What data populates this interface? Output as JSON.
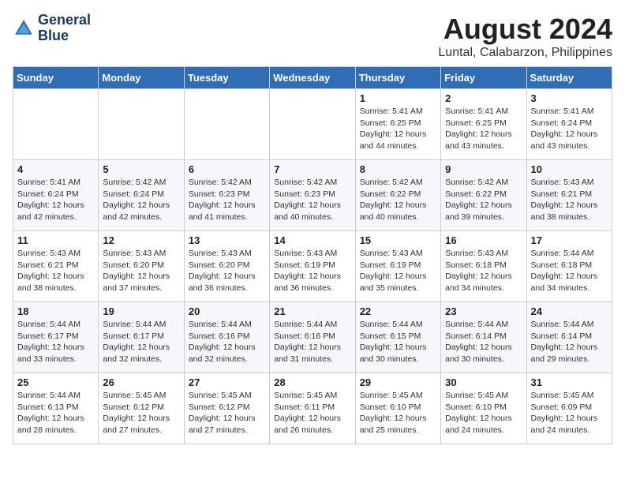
{
  "header": {
    "logo_line1": "General",
    "logo_line2": "Blue",
    "month_year": "August 2024",
    "location": "Luntal, Calabarzon, Philippines"
  },
  "weekdays": [
    "Sunday",
    "Monday",
    "Tuesday",
    "Wednesday",
    "Thursday",
    "Friday",
    "Saturday"
  ],
  "weeks": [
    [
      {
        "day": "",
        "info": ""
      },
      {
        "day": "",
        "info": ""
      },
      {
        "day": "",
        "info": ""
      },
      {
        "day": "",
        "info": ""
      },
      {
        "day": "1",
        "info": "Sunrise: 5:41 AM\nSunset: 6:25 PM\nDaylight: 12 hours\nand 44 minutes."
      },
      {
        "day": "2",
        "info": "Sunrise: 5:41 AM\nSunset: 6:25 PM\nDaylight: 12 hours\nand 43 minutes."
      },
      {
        "day": "3",
        "info": "Sunrise: 5:41 AM\nSunset: 6:24 PM\nDaylight: 12 hours\nand 43 minutes."
      }
    ],
    [
      {
        "day": "4",
        "info": "Sunrise: 5:41 AM\nSunset: 6:24 PM\nDaylight: 12 hours\nand 42 minutes."
      },
      {
        "day": "5",
        "info": "Sunrise: 5:42 AM\nSunset: 6:24 PM\nDaylight: 12 hours\nand 42 minutes."
      },
      {
        "day": "6",
        "info": "Sunrise: 5:42 AM\nSunset: 6:23 PM\nDaylight: 12 hours\nand 41 minutes."
      },
      {
        "day": "7",
        "info": "Sunrise: 5:42 AM\nSunset: 6:23 PM\nDaylight: 12 hours\nand 40 minutes."
      },
      {
        "day": "8",
        "info": "Sunrise: 5:42 AM\nSunset: 6:22 PM\nDaylight: 12 hours\nand 40 minutes."
      },
      {
        "day": "9",
        "info": "Sunrise: 5:42 AM\nSunset: 6:22 PM\nDaylight: 12 hours\nand 39 minutes."
      },
      {
        "day": "10",
        "info": "Sunrise: 5:43 AM\nSunset: 6:21 PM\nDaylight: 12 hours\nand 38 minutes."
      }
    ],
    [
      {
        "day": "11",
        "info": "Sunrise: 5:43 AM\nSunset: 6:21 PM\nDaylight: 12 hours\nand 38 minutes."
      },
      {
        "day": "12",
        "info": "Sunrise: 5:43 AM\nSunset: 6:20 PM\nDaylight: 12 hours\nand 37 minutes."
      },
      {
        "day": "13",
        "info": "Sunrise: 5:43 AM\nSunset: 6:20 PM\nDaylight: 12 hours\nand 36 minutes."
      },
      {
        "day": "14",
        "info": "Sunrise: 5:43 AM\nSunset: 6:19 PM\nDaylight: 12 hours\nand 36 minutes."
      },
      {
        "day": "15",
        "info": "Sunrise: 5:43 AM\nSunset: 6:19 PM\nDaylight: 12 hours\nand 35 minutes."
      },
      {
        "day": "16",
        "info": "Sunrise: 5:43 AM\nSunset: 6:18 PM\nDaylight: 12 hours\nand 34 minutes."
      },
      {
        "day": "17",
        "info": "Sunrise: 5:44 AM\nSunset: 6:18 PM\nDaylight: 12 hours\nand 34 minutes."
      }
    ],
    [
      {
        "day": "18",
        "info": "Sunrise: 5:44 AM\nSunset: 6:17 PM\nDaylight: 12 hours\nand 33 minutes."
      },
      {
        "day": "19",
        "info": "Sunrise: 5:44 AM\nSunset: 6:17 PM\nDaylight: 12 hours\nand 32 minutes."
      },
      {
        "day": "20",
        "info": "Sunrise: 5:44 AM\nSunset: 6:16 PM\nDaylight: 12 hours\nand 32 minutes."
      },
      {
        "day": "21",
        "info": "Sunrise: 5:44 AM\nSunset: 6:16 PM\nDaylight: 12 hours\nand 31 minutes."
      },
      {
        "day": "22",
        "info": "Sunrise: 5:44 AM\nSunset: 6:15 PM\nDaylight: 12 hours\nand 30 minutes."
      },
      {
        "day": "23",
        "info": "Sunrise: 5:44 AM\nSunset: 6:14 PM\nDaylight: 12 hours\nand 30 minutes."
      },
      {
        "day": "24",
        "info": "Sunrise: 5:44 AM\nSunset: 6:14 PM\nDaylight: 12 hours\nand 29 minutes."
      }
    ],
    [
      {
        "day": "25",
        "info": "Sunrise: 5:44 AM\nSunset: 6:13 PM\nDaylight: 12 hours\nand 28 minutes."
      },
      {
        "day": "26",
        "info": "Sunrise: 5:45 AM\nSunset: 6:12 PM\nDaylight: 12 hours\nand 27 minutes."
      },
      {
        "day": "27",
        "info": "Sunrise: 5:45 AM\nSunset: 6:12 PM\nDaylight: 12 hours\nand 27 minutes."
      },
      {
        "day": "28",
        "info": "Sunrise: 5:45 AM\nSunset: 6:11 PM\nDaylight: 12 hours\nand 26 minutes."
      },
      {
        "day": "29",
        "info": "Sunrise: 5:45 AM\nSunset: 6:10 PM\nDaylight: 12 hours\nand 25 minutes."
      },
      {
        "day": "30",
        "info": "Sunrise: 5:45 AM\nSunset: 6:10 PM\nDaylight: 12 hours\nand 24 minutes."
      },
      {
        "day": "31",
        "info": "Sunrise: 5:45 AM\nSunset: 6:09 PM\nDaylight: 12 hours\nand 24 minutes."
      }
    ]
  ]
}
